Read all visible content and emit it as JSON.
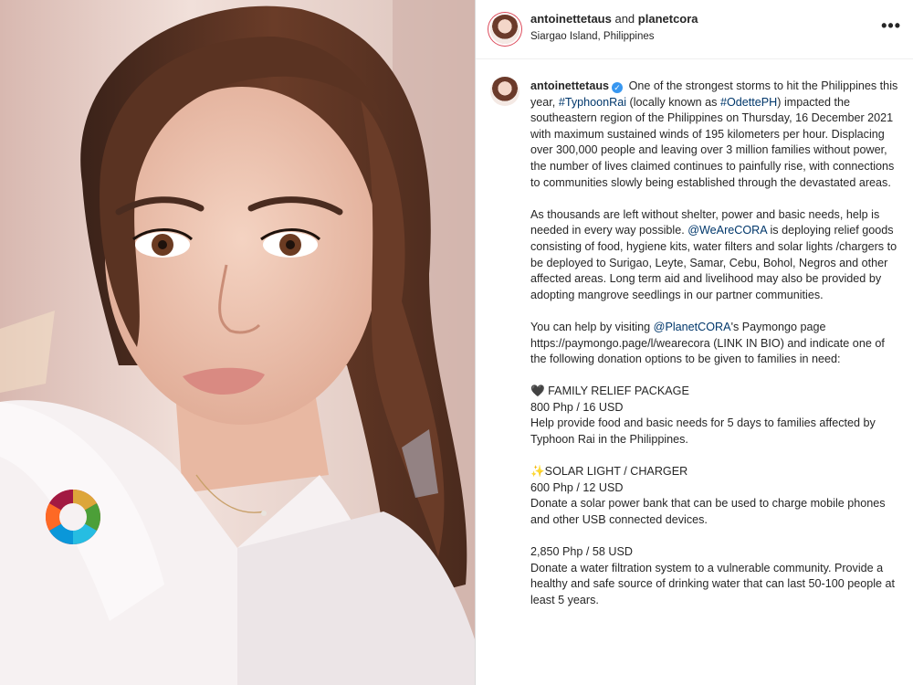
{
  "post": {
    "header": {
      "accounts": "antoinettetaus and planetcora",
      "author_one": "antoinettetaus",
      "joiner": "and",
      "author_two": "planetcora",
      "location": "Siargao Island, Philippines",
      "more_label": "•••"
    },
    "caption": {
      "username": "antoinettetaus",
      "p1_a": "One of the strongest storms to hit the Philippines this year,",
      "tag_typhoon": "#TyphoonRai",
      "p1_b": "(locally known as",
      "tag_odette": "#OdettePH",
      "p1_c": ") impacted the southeastern region of the Philippines on Thursday, 16 December 2021 with maximum sustained winds of 195 kilometers per hour. Displacing over 300,000 people and leaving over 3 million families without power, the number of lives claimed continues to painfully rise, with connections to communities slowly being established through the devastated areas.",
      "p2_a": "As thousands are left without shelter, power and basic needs, help is needed in every way possible.",
      "mention_wearecora": "@WeAreCORA",
      "p2_b": "is deploying relief goods consisting of food, hygiene kits, water filters and solar lights /chargers to be deployed to Surigao, Leyte, Samar, Cebu, Bohol, Negros and other affected areas. Long term aid and livelihood may also be provided by adopting mangrove seedlings in our partner communities.",
      "p3_a": "You can help by visiting",
      "mention_planetcora": "@PlanetCORA",
      "p3_b": "'s Paymongo page https://paymongo.page/l/wearecora (LINK IN BIO) and indicate one of the following donation options to be given to families in need:",
      "options": [
        {
          "title": "🖤 FAMILY RELIEF PACKAGE",
          "price": "800 Php / 16 USD",
          "desc": "Help provide food and basic needs for 5 days to families affected by Typhoon Rai in the Philippines."
        },
        {
          "title": "✨SOLAR LIGHT / CHARGER",
          "price": "600 Php / 12 USD",
          "desc": "Donate a solar power bank that can be used to charge mobile phones and other USB connected devices."
        },
        {
          "title": "",
          "price": "2,850 Php / 58 USD",
          "desc": "Donate a water filtration system to a vulnerable community. Provide a healthy and safe source of drinking water that can last 50-100 people at least 5 years."
        }
      ]
    },
    "colors": {
      "link": "#00376b",
      "verified": "#3897f0",
      "story_ring": "#dd4b5b",
      "text": "#262626"
    }
  }
}
